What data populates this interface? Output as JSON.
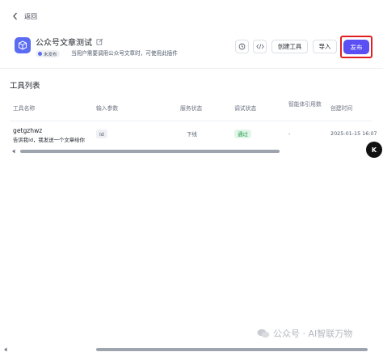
{
  "header": {
    "back_label": "返回",
    "title": "公众号文章测试",
    "status_badge": "未发布",
    "description": "当用户需要调用公众号文章时，可使用此插件"
  },
  "toolbar": {
    "history_icon": "clock-icon",
    "code_icon": "code-icon",
    "create_tool_label": "创建工具",
    "import_label": "导入",
    "publish_label": "发布",
    "publish_color": "#5a4ff3",
    "highlight_color": "#e02020"
  },
  "tool_list": {
    "title": "工具列表",
    "columns": [
      "工具名称",
      "输入参数",
      "服务状态",
      "调试状态",
      "智能体引用数",
      "创建时间"
    ],
    "rows": [
      {
        "name": "getgzhwz",
        "description": "告诉我id，我发送一个文章给你",
        "input_param": "id",
        "service_status": "下线",
        "debug_status": "通过",
        "agent_refs": "-",
        "created_at": "2025-01-15 16:07"
      }
    ]
  },
  "floating_button_label": "K",
  "watermark": "公众号 · AI智联万物"
}
